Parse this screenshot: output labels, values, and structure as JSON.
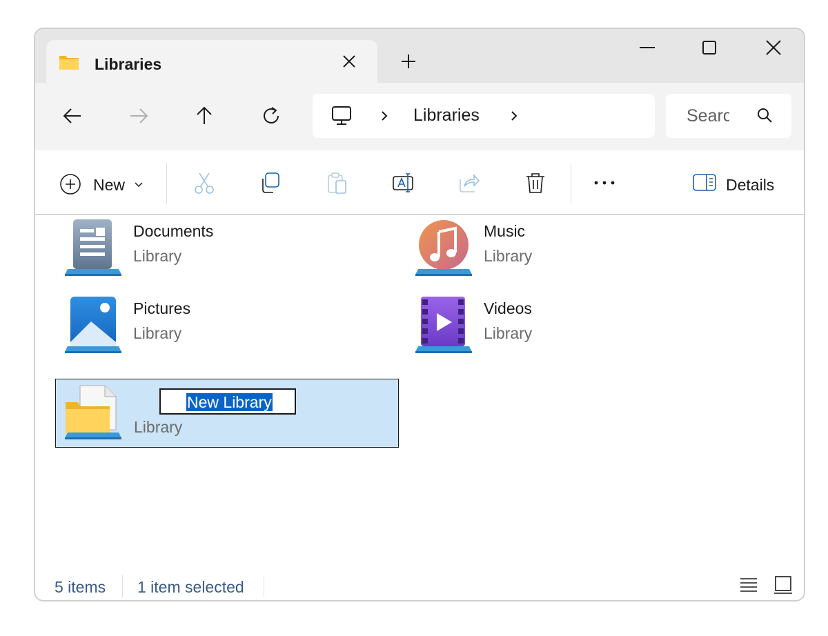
{
  "window": {
    "tab_title": "Libraries",
    "controls": [
      "minimize",
      "maximize",
      "close"
    ]
  },
  "address_bar": {
    "location": "Libraries",
    "search_placeholder": "Search"
  },
  "toolbar": {
    "new_label": "New",
    "details_label": "Details",
    "actions": [
      "cut",
      "copy",
      "paste",
      "rename",
      "share",
      "delete",
      "more"
    ]
  },
  "items": [
    {
      "name": "Documents",
      "type": "Library",
      "icon": "documents-library-icon"
    },
    {
      "name": "Music",
      "type": "Library",
      "icon": "music-library-icon"
    },
    {
      "name": "Pictures",
      "type": "Library",
      "icon": "pictures-library-icon"
    },
    {
      "name": "Videos",
      "type": "Library",
      "icon": "videos-library-icon"
    },
    {
      "name": "New Library",
      "type": "Library",
      "icon": "new-library-icon",
      "selected": true,
      "renaming": true
    }
  ],
  "status": {
    "item_count": "5 items",
    "selection": "1 item selected"
  },
  "colors": {
    "accent": "#0a64c8",
    "selection_bg": "#cce4f7",
    "titlebar_bg": "#e6e6e6",
    "navbar_bg": "#f3f3f3"
  }
}
